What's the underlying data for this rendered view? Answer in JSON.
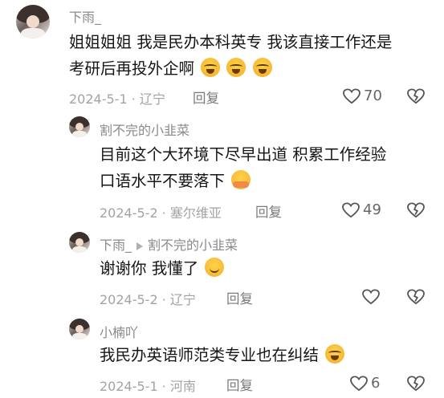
{
  "comments": [
    {
      "username": "下雨_",
      "text_line1": "姐姐姐姐 我是民办本科英专 我该直接工作还是",
      "text_line2": "考研后再投外企啊",
      "date": "2024-5-1",
      "location": "辽宁",
      "reply_label": "回复",
      "likes": "70",
      "emoji": [
        "crying-face-emoji",
        "crying-face-emoji",
        "crying-face-emoji"
      ]
    },
    {
      "username": "割不完的小韭菜",
      "text_line1": "目前这个大环境下尽早出道 积累工作经验",
      "text_line2": "口语水平不要落下",
      "date": "2024-5-2",
      "location": "塞尔维亚",
      "reply_label": "回复",
      "likes": "49",
      "emoji": [
        "hugging-emoji"
      ]
    },
    {
      "username": "下雨_",
      "reply_to": "割不完的小韭菜",
      "text_line1": "谢谢你  我懂了",
      "date": "2024-5-2",
      "location": "辽宁",
      "reply_label": "回复",
      "likes": "",
      "emoji": [
        "smiling-face-emoji"
      ]
    },
    {
      "username": "小楠吖",
      "text_line1": "我民办英语师范类专业也在纠结",
      "date": "2024-5-1",
      "location": "河南",
      "reply_label": "回复",
      "likes": "6",
      "emoji": [
        "crying-face-emoji"
      ]
    }
  ],
  "meta_separator": "·",
  "colors": {
    "text": "#161616",
    "meta": "#a3a3a3",
    "username": "#8a8a8a",
    "icon": "#555555"
  }
}
